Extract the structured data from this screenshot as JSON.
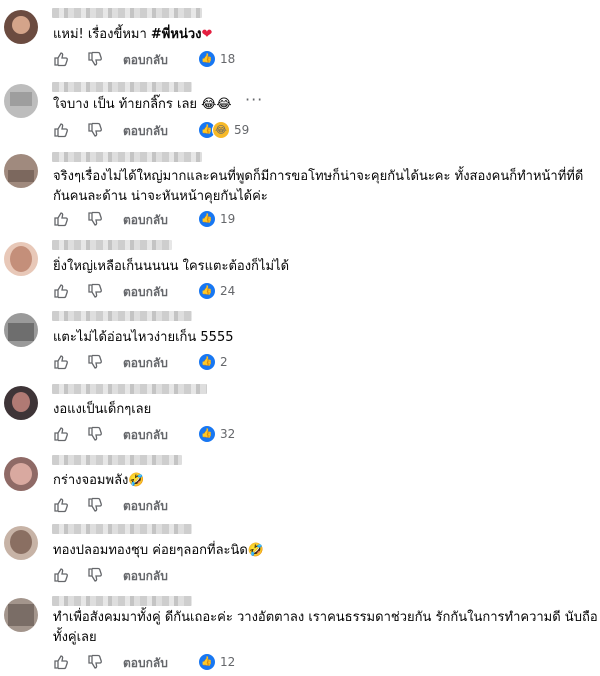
{
  "reply_label": "ตอบกลับ",
  "more_label": "···",
  "comments": [
    {
      "text_plain": "แหม่! เรื่องขี้หมา ",
      "text_bold": "#พี่หน่วง",
      "emoji": "❤",
      "reactions": "like",
      "count": "18"
    },
    {
      "text": "ใจบาง เป็น ท้ายกลิ๊กร เลย 😂😂",
      "reactions": "like+haha",
      "count": "59"
    },
    {
      "text_line1": "จริงๆเรื่องไม่ได้ใหญ่มากและคนที่พูดก็มีการขอโทษก็น่าจะคุยกันได้นะคะ ทั้งสองคนก็ทำหน้าที่ที่ดี",
      "text_line2": "กันคนละด้าน น่าจะหันหน้าคุยกันได้ค่ะ",
      "reactions": "like",
      "count": "19"
    },
    {
      "text": "ยิ่งใหญ่เหลือเก็นนนนน ใครแตะต้องก็ไม่ได้",
      "reactions": "like",
      "count": "24"
    },
    {
      "text": "แตะไม่ได้อ่อนไหวง่ายเก็น 5555",
      "reactions": "like",
      "count": "2"
    },
    {
      "text": "งอแงเป็นเด็กๆเลย",
      "reactions": "like",
      "count": "32"
    },
    {
      "text": "กร่างจอมพลัง🤣",
      "reactions": "",
      "count": ""
    },
    {
      "text": "ทองปลอมทองชุบ ค่อยๆลอกที่ละนิด🤣",
      "reactions": "",
      "count": ""
    },
    {
      "text_line1": "ทำเพื่อสังคมมาทั้งคู่ ดีกันเถอะค่ะ วางอัตตาลง เราคนธรรมดาช่วยกัน รักกันในการทำความดี นับถือ",
      "text_line2": "ทั้งคู่เลย",
      "reactions": "like",
      "count": "12"
    }
  ],
  "colors": {
    "like_blue": "#1877f2",
    "meta_gray": "#65676b",
    "heart_red": "#e41e3f"
  }
}
